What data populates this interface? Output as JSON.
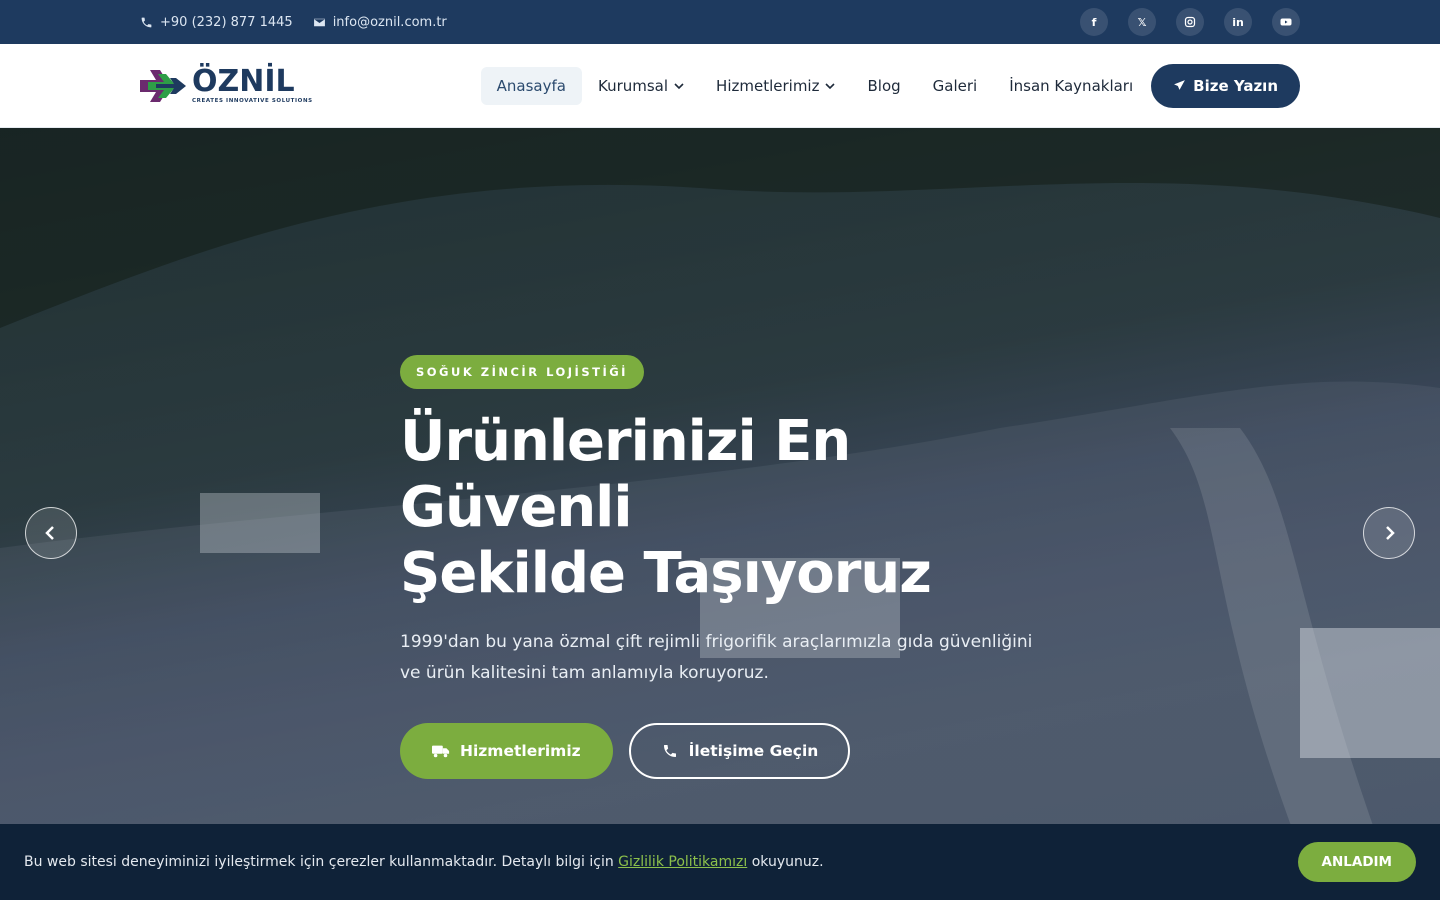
{
  "topbar": {
    "phone": "+90 (232) 877 1445",
    "email": "info@oznil.com.tr",
    "socials": [
      {
        "icon": "facebook-icon",
        "label": "f"
      },
      {
        "icon": "x-twitter-icon",
        "label": "𝕏"
      },
      {
        "icon": "instagram-icon",
        "label": ""
      },
      {
        "icon": "linkedin-icon",
        "label": "in"
      },
      {
        "icon": "youtube-icon",
        "label": ""
      }
    ]
  },
  "brand": {
    "name": "ÖZNİL",
    "tagline": "CREATES INNOVATIVE SOLUTIONS",
    "colors": {
      "primary": "#1e3a5f",
      "accent": "#7cad3f"
    }
  },
  "nav": {
    "items": [
      {
        "label": "Anasayfa",
        "active": true
      },
      {
        "label": "Kurumsal",
        "dropdown": true
      },
      {
        "label": "Hizmetlerimiz",
        "dropdown": true
      },
      {
        "label": "Blog"
      },
      {
        "label": "Galeri"
      },
      {
        "label": "İnsan Kaynakları"
      }
    ],
    "cta": "Bize Yazın"
  },
  "hero": {
    "badge": "SOĞUK ZİNCİR LOJİSTİĞİ",
    "title_line1": "Ürünlerinizi En Güvenli",
    "title_line2": "Şekilde Taşıyoruz",
    "subtitle": "1999'dan bu yana özmal çift rejimli frigorifik araçlarımızla gıda güvenliğini ve ürün kalitesini tam anlamıyla koruyoruz.",
    "primary_button": "Hizmetlerimiz",
    "secondary_button": "İletişime Geçin"
  },
  "cookie": {
    "text_before": "Bu web sitesi deneyiminizi iyileştirmek için çerezler kullanmaktadır. Detaylı bilgi için ",
    "link": "Gizlilik Politikamızı",
    "text_after": " okuyunuz.",
    "button": "ANLADIM"
  }
}
